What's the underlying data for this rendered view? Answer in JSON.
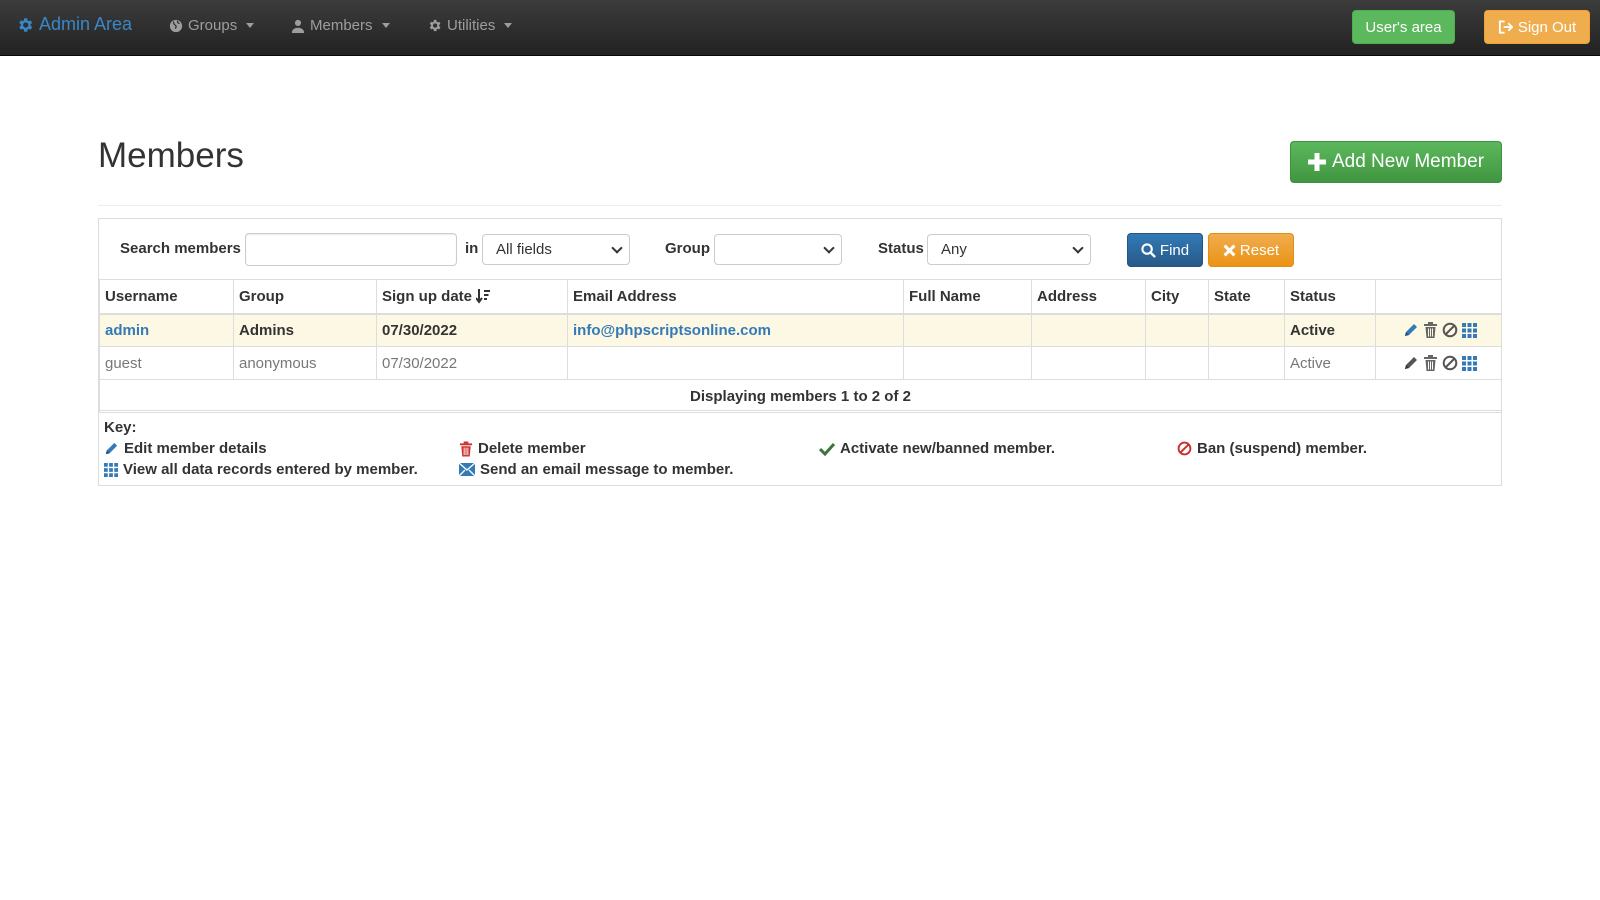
{
  "navbar": {
    "brand": "Admin Area",
    "items": [
      {
        "label": "Groups"
      },
      {
        "label": "Members"
      },
      {
        "label": "Utilities"
      }
    ],
    "users_area": "User's area",
    "sign_out": "Sign Out"
  },
  "page": {
    "title": "Members",
    "add_button": "Add New Member"
  },
  "search": {
    "label": "Search members",
    "value": "",
    "in_label": "in",
    "field_select": "All fields",
    "group_label": "Group",
    "group_select": "",
    "status_label": "Status",
    "status_select": "Any",
    "find": "Find",
    "reset": "Reset"
  },
  "table": {
    "headers": [
      "Username",
      "Group",
      "Sign up date",
      "Email Address",
      "Full Name",
      "Address",
      "City",
      "State",
      "Status"
    ],
    "rows": [
      {
        "username": "admin",
        "group": "Admins",
        "signup": "07/30/2022",
        "email": "info@phpscriptsonline.com",
        "fullname": "",
        "address": "",
        "city": "",
        "state": "",
        "status": "Active"
      },
      {
        "username": "guest",
        "group": "anonymous",
        "signup": "07/30/2022",
        "email": "",
        "fullname": "",
        "address": "",
        "city": "",
        "state": "",
        "status": "Active"
      }
    ],
    "footer": "Displaying members 1 to 2 of 2"
  },
  "key": {
    "title": "Key:",
    "edit": "Edit member details",
    "delete": "Delete member",
    "activate": "Activate new/banned member.",
    "ban": "Ban (suspend) member.",
    "view": "View all data records entered by member.",
    "email": "Send an email message to member."
  },
  "colors": {
    "navbar": "#222222",
    "brand": "#3a87c8",
    "success": "#5cb85c",
    "warning": "#f0ad4e",
    "primary": "#337ab7",
    "danger": "#c9302c",
    "highlight_row": "#fcf8e3"
  }
}
